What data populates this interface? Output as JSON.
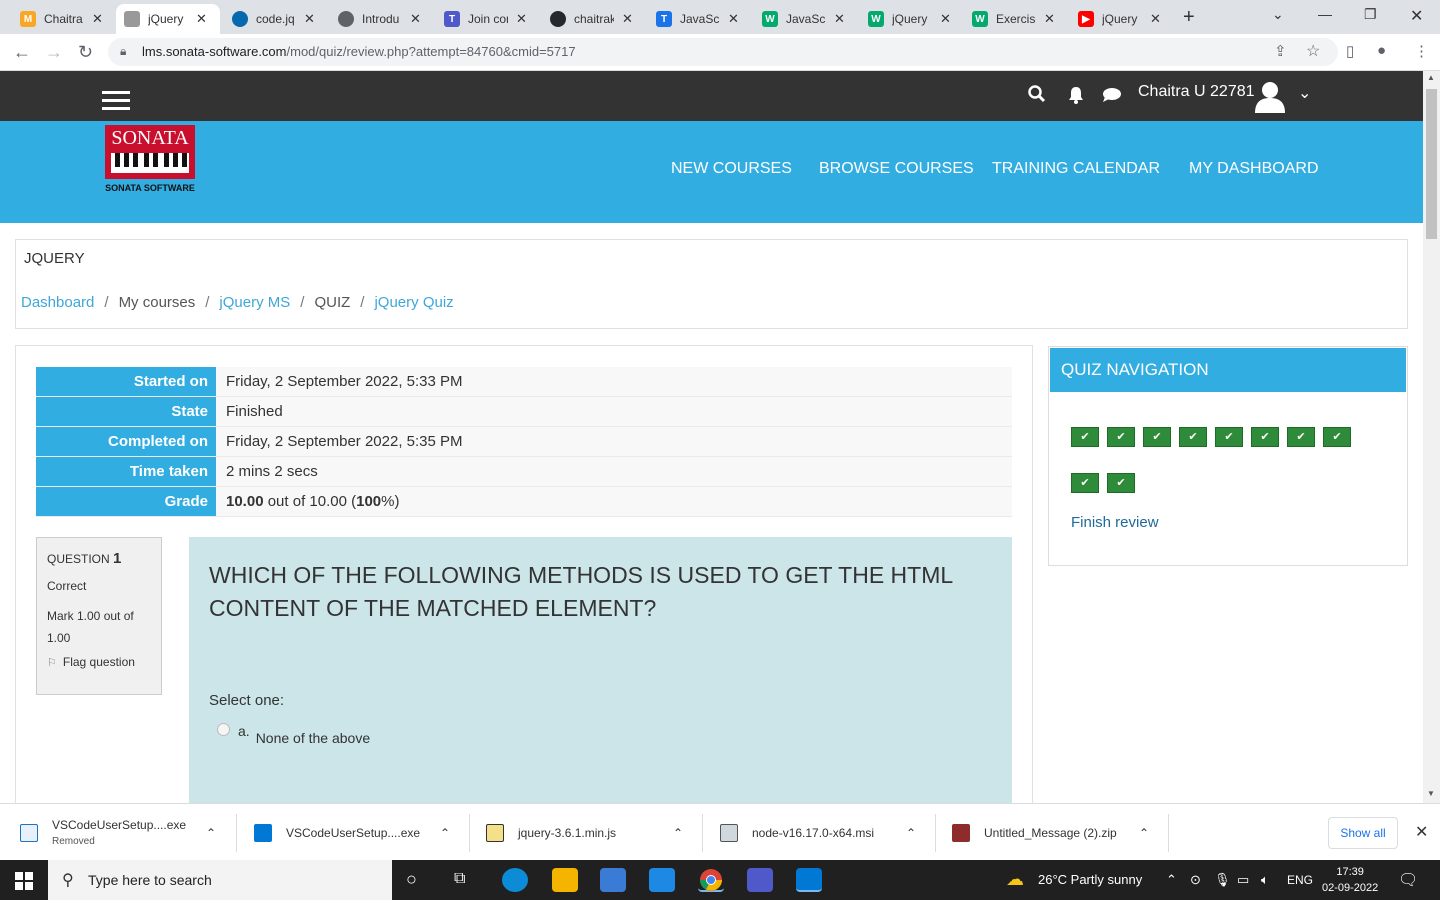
{
  "browser": {
    "tabs": [
      {
        "title": "Chaitra",
        "icon": "moodle-icon",
        "color": "#f9a825"
      },
      {
        "title": "jQuery",
        "icon": "page-icon",
        "color": "#888888"
      },
      {
        "title": "code.jq",
        "icon": "jquery-icon",
        "color": "#0769ad"
      },
      {
        "title": "Introdu",
        "icon": "globe-icon",
        "color": "#5f6368"
      },
      {
        "title": "Join cor",
        "icon": "teams-icon",
        "color": "#5059c9"
      },
      {
        "title": "chaitrak",
        "icon": "github-icon",
        "color": "#24292e"
      },
      {
        "title": "JavaScri",
        "icon": "t-icon",
        "color": "#1a73e8"
      },
      {
        "title": "JavaScri",
        "icon": "w3-icon",
        "color": "#04aa6d"
      },
      {
        "title": "jQuery",
        "icon": "w3-icon",
        "color": "#04aa6d"
      },
      {
        "title": "Exercise",
        "icon": "w3-icon",
        "color": "#04aa6d"
      },
      {
        "title": "jQuery",
        "icon": "youtube-icon",
        "color": "#ff0000"
      }
    ],
    "url_host": "lms.sonata-software.com",
    "url_path": "/mod/quiz/review.php?attempt=84760&cmid=5717"
  },
  "header": {
    "username": "Chaitra U 22781"
  },
  "logo": {
    "word": "SONATA",
    "sub": "SONATA SOFTWARE"
  },
  "nav": {
    "items": [
      "NEW COURSES",
      "BROWSE COURSES",
      "TRAINING CALENDAR",
      "MY DASHBOARD"
    ]
  },
  "course": {
    "title": "JQUERY",
    "breadcrumb": [
      "Dashboard",
      "My courses",
      "jQuery MS",
      "QUIZ",
      "jQuery Quiz"
    ]
  },
  "summary": {
    "rows": [
      {
        "label": "Started on",
        "value": "Friday, 2 September 2022, 5:33 PM"
      },
      {
        "label": "State",
        "value": "Finished"
      },
      {
        "label": "Completed on",
        "value": "Friday, 2 September 2022, 5:35 PM"
      },
      {
        "label": "Time taken",
        "value": "2 mins 2 secs"
      }
    ],
    "grade_label": "Grade",
    "grade_score": "10.00",
    "grade_mid": " out of 10.00 (",
    "grade_pct": "100",
    "grade_end": "%)"
  },
  "question": {
    "label": "QUESTION",
    "number": "1",
    "status": "Correct",
    "mark": "Mark 1.00 out of 1.00",
    "flag": "Flag question",
    "text": "WHICH OF THE FOLLOWING METHODS IS USED TO GET THE HTML CONTENT OF THE MATCHED ELEMENT?",
    "select_label": "Select one:",
    "options": [
      {
        "letter": "a.",
        "text": "None of the above"
      }
    ]
  },
  "quiz_nav": {
    "title": "QUIZ NAVIGATION",
    "question_count": 10,
    "all_correct": true,
    "finish_label": "Finish review"
  },
  "downloads": [
    {
      "name": "VSCodeUserSetup....exe",
      "status": "Removed"
    },
    {
      "name": "VSCodeUserSetup....exe",
      "status": ""
    },
    {
      "name": "jquery-3.6.1.min.js",
      "status": ""
    },
    {
      "name": "node-v16.17.0-x64.msi",
      "status": ""
    },
    {
      "name": "Untitled_Message (2).zip",
      "status": ""
    }
  ],
  "downloads_show_all": "Show all",
  "taskbar": {
    "search_placeholder": "Type here to search",
    "weather": "26°C  Partly sunny",
    "lang": "ENG",
    "time": "17:39",
    "date": "02-09-2022"
  },
  "colors": {
    "brand_blue": "#31ade2",
    "topbar": "#333333",
    "correct_green": "#2e8b3a",
    "question_bg": "#cce5e9"
  }
}
